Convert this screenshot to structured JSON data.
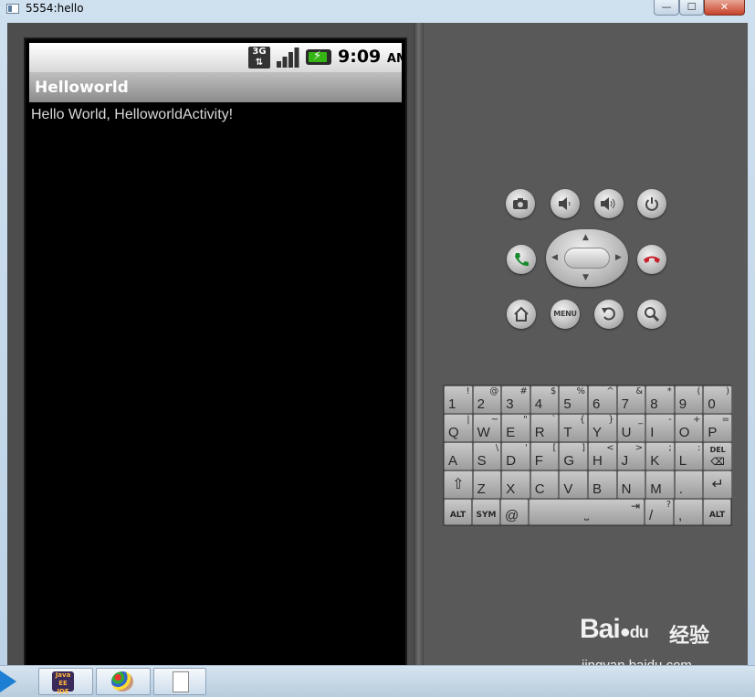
{
  "window": {
    "title": "5554:hello",
    "controls": {
      "minimize": "—",
      "maximize": "☐",
      "close": "✕"
    }
  },
  "phone": {
    "status_bar": {
      "network_type": "3G",
      "time": "9:09",
      "ampm": "AM"
    },
    "app_title": "Helloworld",
    "content_text": "Hello World, HelloworldActivity!"
  },
  "controls": {
    "camera": "camera-icon",
    "volume_down": "volume-down-icon",
    "volume_up": "volume-up-icon",
    "power": "power-icon",
    "call": "call-icon",
    "end_call": "end-call-icon",
    "home": "home-icon",
    "menu_label": "MENU",
    "back": "back-icon",
    "search": "search-icon"
  },
  "keyboard": {
    "rows": [
      [
        {
          "main": "1",
          "sub": "!"
        },
        {
          "main": "2",
          "sub": "@"
        },
        {
          "main": "3",
          "sub": "#"
        },
        {
          "main": "4",
          "sub": "$"
        },
        {
          "main": "5",
          "sub": "%"
        },
        {
          "main": "6",
          "sub": "^"
        },
        {
          "main": "7",
          "sub": "&"
        },
        {
          "main": "8",
          "sub": "*"
        },
        {
          "main": "9",
          "sub": "("
        },
        {
          "main": "0",
          "sub": ")"
        }
      ],
      [
        {
          "main": "Q",
          "sub": "|"
        },
        {
          "main": "W",
          "sub": "~"
        },
        {
          "main": "E",
          "sub": "\""
        },
        {
          "main": "R",
          "sub": "`"
        },
        {
          "main": "T",
          "sub": "{"
        },
        {
          "main": "Y",
          "sub": "}"
        },
        {
          "main": "U",
          "sub": "_"
        },
        {
          "main": "I",
          "sub": "-"
        },
        {
          "main": "O",
          "sub": "+"
        },
        {
          "main": "P",
          "sub": "="
        }
      ],
      [
        {
          "main": "A",
          "sub": ""
        },
        {
          "main": "S",
          "sub": "\\"
        },
        {
          "main": "D",
          "sub": "'"
        },
        {
          "main": "F",
          "sub": "["
        },
        {
          "main": "G",
          "sub": "]"
        },
        {
          "main": "H",
          "sub": "<"
        },
        {
          "main": "J",
          "sub": ">"
        },
        {
          "main": "K",
          "sub": ";"
        },
        {
          "main": "L",
          "sub": ":"
        },
        {
          "main": "DEL",
          "sub": "⌫"
        }
      ],
      [
        {
          "main": "⇧",
          "sub": ""
        },
        {
          "main": "Z",
          "sub": ""
        },
        {
          "main": "X",
          "sub": ""
        },
        {
          "main": "C",
          "sub": ""
        },
        {
          "main": "V",
          "sub": ""
        },
        {
          "main": "B",
          "sub": ""
        },
        {
          "main": "N",
          "sub": ""
        },
        {
          "main": "M",
          "sub": ""
        },
        {
          "main": ".",
          "sub": ""
        },
        {
          "main": "↵",
          "sub": ""
        }
      ]
    ],
    "bottom_row": {
      "alt_left": "ALT",
      "sym": "SYM",
      "at": "@",
      "space_symbol": "⎵",
      "space_tab": "⇥",
      "slash": "/",
      "question": "?",
      "comma": ",",
      "alt_right": "ALT"
    }
  },
  "watermark": {
    "logo_text": "Bai",
    "logo_text_2": "du",
    "chinese": "经验",
    "url": "jingyan.baidu.com"
  },
  "taskbar": {
    "java_icon_text": "Java EE IDE"
  }
}
